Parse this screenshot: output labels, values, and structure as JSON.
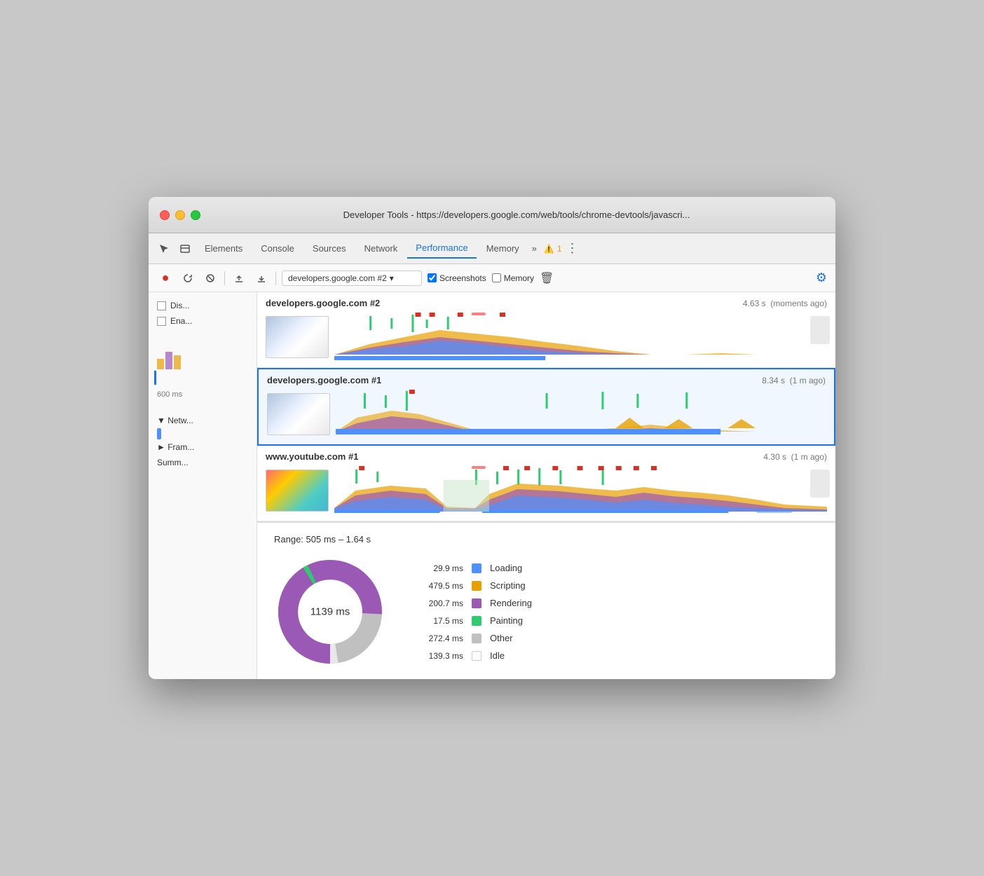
{
  "window": {
    "title": "Developer Tools - https://developers.google.com/web/tools/chrome-devtools/javascri..."
  },
  "tabs": {
    "items": [
      {
        "label": "Elements",
        "active": false
      },
      {
        "label": "Console",
        "active": false
      },
      {
        "label": "Sources",
        "active": false
      },
      {
        "label": "Network",
        "active": false
      },
      {
        "label": "Performance",
        "active": true
      },
      {
        "label": "Memory",
        "active": false
      }
    ],
    "overflow": "»",
    "warning_count": "1",
    "more_icon": "⋮"
  },
  "toolbar": {
    "url_value": "developers.google.com #2",
    "screenshots_label": "Screenshots",
    "memory_label": "Memory"
  },
  "left_panel": {
    "checkbox1": "Dis...",
    "checkbox2": "Ena...",
    "time_label": "600 ms",
    "network_label": "▼ Netw...",
    "frames_label": "► Fram...",
    "summary_label": "Summ..."
  },
  "recordings": [
    {
      "id": "rec1",
      "title": "developers.google.com #2",
      "time": "4.63 s",
      "ago": "(moments ago)",
      "selected": false
    },
    {
      "id": "rec2",
      "title": "developers.google.com #1",
      "time": "8.34 s",
      "ago": "(1 m ago)",
      "selected": true
    },
    {
      "id": "rec3",
      "title": "www.youtube.com #1",
      "time": "4.30 s",
      "ago": "(1 m ago)",
      "selected": false
    }
  ],
  "summary": {
    "range_label": "Range: 505 ms – 1.64 s",
    "total_ms": "1139 ms",
    "legend": [
      {
        "value": "29.9 ms",
        "name": "Loading",
        "color": "#4d90fe"
      },
      {
        "value": "479.5 ms",
        "name": "Scripting",
        "color": "#e8a000"
      },
      {
        "value": "200.7 ms",
        "name": "Rendering",
        "color": "#9b59b6"
      },
      {
        "value": "17.5 ms",
        "name": "Painting",
        "color": "#2ecc71"
      },
      {
        "value": "272.4 ms",
        "name": "Other",
        "color": "#c0c0c0"
      },
      {
        "value": "139.3 ms",
        "name": "Idle",
        "color": "#ffffff"
      }
    ]
  },
  "colors": {
    "accent": "#1a73e8",
    "loading": "#4d90fe",
    "scripting": "#e8a000",
    "rendering": "#9b59b6",
    "painting": "#2ecc71",
    "other": "#c0c0c0",
    "idle": "#ffffff"
  }
}
